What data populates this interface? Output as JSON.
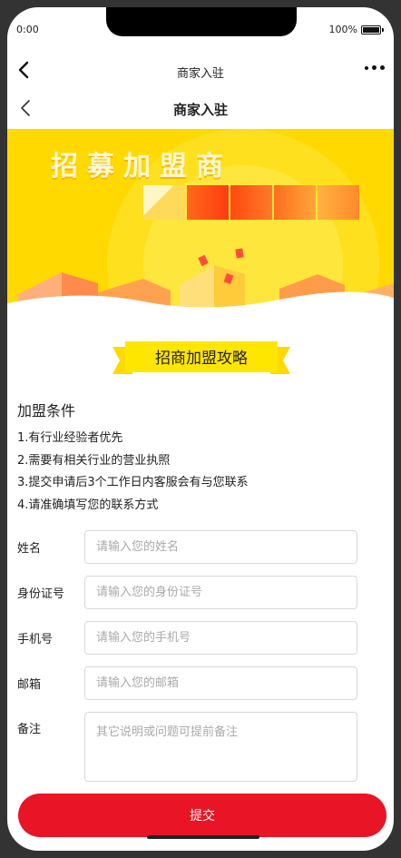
{
  "status": {
    "time": "0:00",
    "battery": "100%"
  },
  "wx_nav": {
    "title": "商家入驻"
  },
  "page_nav": {
    "title": "商家入驻"
  },
  "banner": {
    "headline": "招募加盟商"
  },
  "guide": {
    "ribbon_label": "招商加盟攻略",
    "conditions_title": "加盟条件",
    "conditions": [
      "1.有行业经验者优先",
      "2.需要有相关行业的营业执照",
      "3.提交申请后3个工作日内客服会有与您联系",
      "4.请准确填写您的联系方式"
    ]
  },
  "form": {
    "name": {
      "label": "姓名",
      "value": "",
      "placeholder": "请输入您的姓名"
    },
    "id_card": {
      "label": "身份证号",
      "value": "",
      "placeholder": "请输入您的身份证号"
    },
    "phone": {
      "label": "手机号",
      "value": "",
      "placeholder": "请输入您的手机号"
    },
    "email": {
      "label": "邮箱",
      "value": "",
      "placeholder": "请输入您的邮箱"
    },
    "remark": {
      "label": "备注",
      "value": "",
      "placeholder": "其它说明或问题可提前备注"
    }
  },
  "submit_label": "提交",
  "colors": {
    "accent": "#e91426",
    "banner": "#ffd900"
  },
  "icons": {
    "back": "chevron-left-icon",
    "more": "more-dots-icon"
  }
}
